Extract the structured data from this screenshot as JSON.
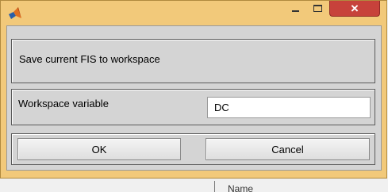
{
  "window": {
    "app_icon": "matlab-logo-icon",
    "controls": {
      "minimize_icon": "minimize-icon",
      "maximize_icon": "maximize-icon",
      "close_icon": "close-icon",
      "close_glyph": "×"
    },
    "frame_color": "#f2c97a",
    "close_color": "#c7423b"
  },
  "dialog": {
    "header": "Save current FIS to workspace",
    "variable_label": "Workspace variable",
    "variable_value": "DC",
    "ok_label": "OK",
    "cancel_label": "Cancel"
  },
  "background": {
    "visible_text": "Name"
  }
}
